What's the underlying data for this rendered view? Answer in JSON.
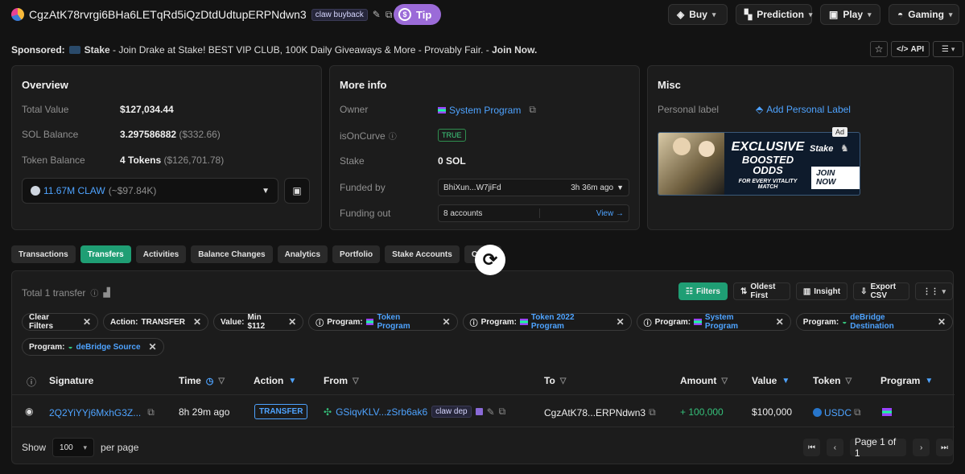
{
  "header": {
    "address": "CgzAtK78rvrgi6BHa6LETqRd5iQzDtdUdtupERPNdwn3",
    "tag": "claw buyback",
    "tip_label": "Tip",
    "nav": [
      {
        "label": "Buy",
        "icon": "tag-icon"
      },
      {
        "label": "Prediction",
        "icon": "prediction-icon"
      },
      {
        "label": "Play",
        "icon": "play-icon"
      },
      {
        "label": "Gaming",
        "icon": "gamepad-icon"
      }
    ]
  },
  "sponsored": {
    "prefix": "Sponsored:",
    "brand": "Stake",
    "text": " - Join Drake at Stake! BEST VIP CLUB, 100K Daily Giveaways & More - Provably Fair. - ",
    "cta": "Join Now.",
    "api_label": "API"
  },
  "overview": {
    "title": "Overview",
    "total_value_label": "Total Value",
    "total_value": "$127,034.44",
    "sol_label": "SOL Balance",
    "sol_value": "3.297586882",
    "sol_usd": "($332.66)",
    "token_label": "Token Balance",
    "token_value": "4 Tokens",
    "token_usd": "($126,701.78)",
    "selected_token": "11.67M CLAW",
    "selected_token_usd": "(~$97.84K)"
  },
  "more_info": {
    "title": "More info",
    "owner_label": "Owner",
    "owner_value": "System Program",
    "oncurve_label": "isOnCurve",
    "oncurve_value": "TRUE",
    "stake_label": "Stake",
    "stake_value": "0 SOL",
    "funded_label": "Funded by",
    "funded_addr": "BhiXun...W7jiFd",
    "funded_time": "3h 36m ago",
    "funding_out_label": "Funding out",
    "funding_out_value": "8 accounts",
    "view_label": "View →"
  },
  "misc": {
    "title": "Misc",
    "personal_label": "Personal label",
    "add_label": "Add Personal Label",
    "ad_badge": "Ad",
    "ad_line1": "EXCLUSIVE",
    "ad_line2": "BOOSTED ODDS",
    "ad_line3": "FOR EVERY VITALITY MATCH",
    "ad_brand": "Stake",
    "ad_cta": "JOIN NOW"
  },
  "tabs": [
    "Transactions",
    "Transfers",
    "Activities",
    "Balance Changes",
    "Analytics",
    "Portfolio",
    "Stake Accounts",
    "Cards"
  ],
  "active_tab": "Transfers",
  "transfers": {
    "total_label": "Total 1 transfer",
    "filters_btn": "Filters",
    "oldest_btn": "Oldest First",
    "insight_btn": "Insight",
    "export_btn": "Export CSV",
    "clear_filters": "Clear Filters",
    "pills": [
      {
        "label": "Action:",
        "value": "TRANSFER"
      },
      {
        "label": "Value:",
        "value": "Min $112"
      },
      {
        "label": "Program:",
        "value": "Token Program"
      },
      {
        "label": "Program:",
        "value": "Token 2022 Program"
      },
      {
        "label": "Program:",
        "value": "System Program"
      },
      {
        "label": "Program:",
        "value": "deBridge Destination"
      },
      {
        "label": "Program:",
        "value": "deBridge Source"
      }
    ],
    "columns": [
      "Signature",
      "Time",
      "Action",
      "From",
      "To",
      "Amount",
      "Value",
      "Token",
      "Program"
    ],
    "rows": [
      {
        "signature": "2Q2YiYYj6MxhG3Z...",
        "time": "8h 29m ago",
        "action": "TRANSFER",
        "from": "GSiqvKLV...zSrb6ak6",
        "from_tag": "claw dep",
        "to": "CgzAtK78...ERPNdwn3",
        "amount": "+ 100,000",
        "value": "$100,000",
        "token": "USDC"
      }
    ],
    "show_label": "Show",
    "per_page": "100",
    "per_page_label": "per page",
    "page_label": "Page 1 of 1"
  },
  "colors": {
    "accent": "#1f9e74",
    "link": "#4ea3ff",
    "tip": "#9b6bd8",
    "positive": "#35c07a"
  }
}
